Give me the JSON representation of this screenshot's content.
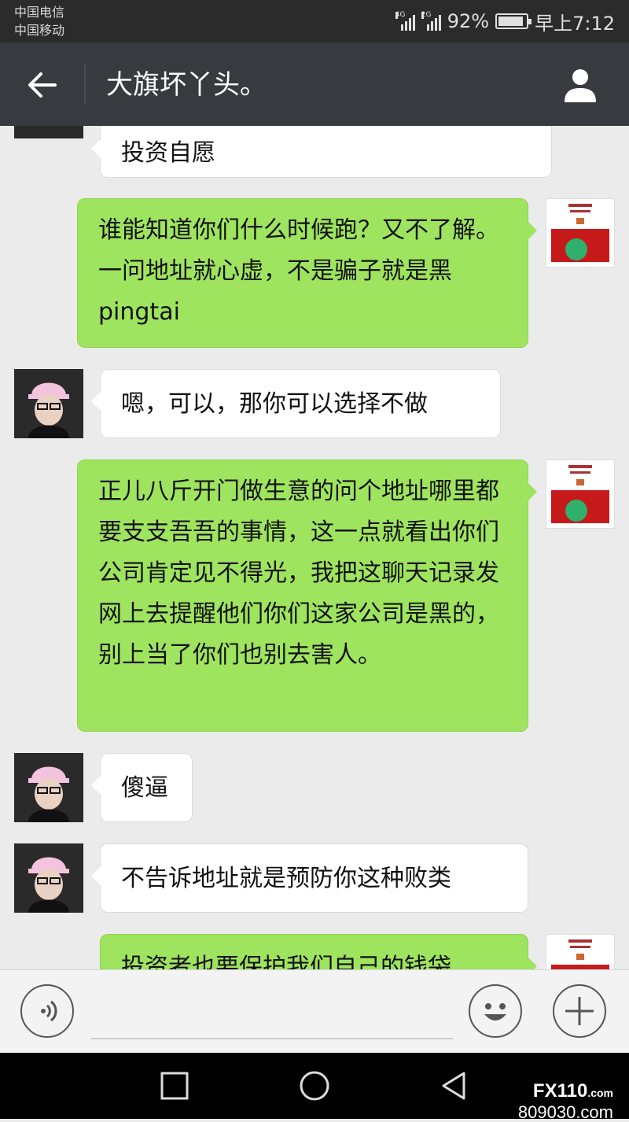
{
  "status_bar": {
    "carrier1": "中国电信",
    "carrier2": "中国移动",
    "net1": "4G",
    "net2": "2G",
    "battery": "92%",
    "battery_level": 0.92,
    "time": "早上7:12"
  },
  "header": {
    "title": "大旗坏丫头。"
  },
  "messages": [
    {
      "side": "in",
      "text": "投资自愿"
    },
    {
      "side": "out",
      "text": "谁能知道你们什么时候跑？又不了解。一问地址就心虚，不是骗子就是黑 pingtai"
    },
    {
      "side": "in",
      "text": "嗯，可以，那你可以选择不做"
    },
    {
      "side": "out",
      "text": "正儿八斤开门做生意的问个地址哪里都要支支吾吾的事情，这一点就看出你们公司肯定见不得光，我把这聊天记录发网上去提醒他们你们这家公司是黑的，别上当了你们也别去害人。"
    },
    {
      "side": "in",
      "text": "傻逼"
    },
    {
      "side": "in",
      "text": "不告诉地址就是预防你这种败类"
    },
    {
      "side": "out",
      "text": "投资者也要保护我们自己的钱袋"
    }
  ],
  "watermark": {
    "brand": "FX110",
    "brand_suffix": ".com",
    "domain": "809030.com"
  },
  "colors": {
    "title_bar": "#393a3f",
    "out_bubble": "#9fe45e",
    "in_bubble": "#ffffff",
    "chat_bg": "#ebebeb"
  }
}
